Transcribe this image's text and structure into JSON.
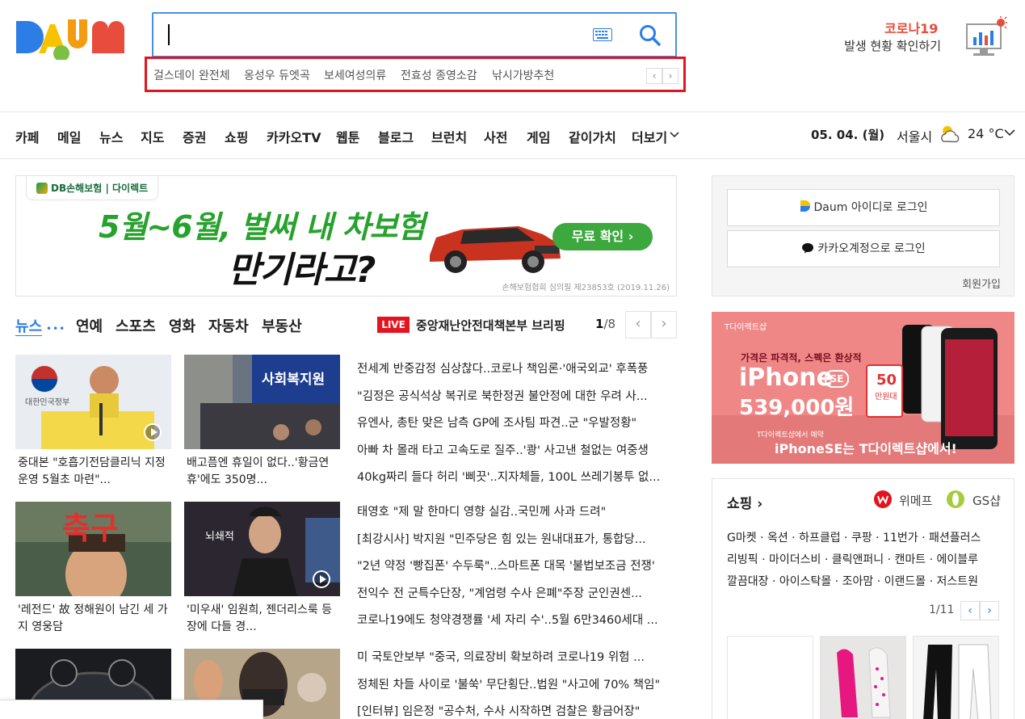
{
  "search": {
    "trends": [
      "걸스데이 완전체",
      "옹성우 듀엣곡",
      "보세여성의류",
      "전효성 종영소감",
      "낚시가방추천"
    ],
    "trend_prev": "‹",
    "trend_next": "›"
  },
  "covid": {
    "title": "코로나19",
    "subtitle": "발생 현황 확인하기"
  },
  "nav": {
    "items": [
      "카페",
      "메일",
      "뉴스",
      "지도",
      "증권",
      "쇼핑",
      "카카오TV",
      "웹툰",
      "블로그",
      "브런치",
      "사전",
      "게임",
      "같이가치",
      "더보기"
    ],
    "date": "05. 04. (월)",
    "city": "서울시",
    "temp": "24 °C"
  },
  "ad": {
    "brand": "DB손해보험 | 다이렉트",
    "line1": "5월~6월, 벌써 내 차보험",
    "line2": "만기라고?",
    "cta": "무료 확인 ›",
    "note": "손해보험협회 심의필 제23853호 (2019.11.26)"
  },
  "news": {
    "tabs": [
      "뉴스",
      "연예",
      "스포츠",
      "영화",
      "자동차",
      "부동산"
    ],
    "dots": "•••",
    "live_badge": "LIVE",
    "live_text": "중앙재난안전대책본부 브리핑",
    "page_current": "1",
    "page_total": "/8",
    "prev": "‹",
    "next": "›",
    "cards": [
      {
        "caption": "중대본 \"호흡기전담클리닉 지정운영 5월초 마련\"...",
        "thumb_text": "대한민국정부"
      },
      {
        "caption": "배고픔엔 휴일이 없다..'황금연휴'에도 350명...",
        "thumb_text": "사회복지원"
      },
      {
        "caption": "'레전드' 故 정해원이 남긴 세 가지 영웅담",
        "thumb_text": "축구"
      },
      {
        "caption": "'미우새' 임원희, 젠더리스룩 등장에 다들 경...",
        "thumb_text": "뇌쇄적"
      }
    ],
    "headlines_a": [
      "전세계 반중감정 심상찮다..코로나 책임론·'애국외교' 후폭풍",
      "\"김정은 공식석상 복귀로 북한정권 불안정에 대한 우려 사...",
      "유엔사, 총탄 맞은 남측 GP에 조사팀 파견..군 \"우발정황\"",
      "아빠 차 몰래 타고 고속도로 질주..'쾅' 사고낸 철없는 여중생",
      "40kg짜리 들다 허리 '삐끗'..지자체들, 100L 쓰레기봉투 없..."
    ],
    "headlines_b": [
      "태영호 \"제 말 한마디 영향 실감..국민께 사과 드려\"",
      "[최강시사] 박지원 \"민주당은 힘 있는 원내대표가, 통합당...",
      "\"2년 약정 '빵집폰' 수두룩\"..스마트폰 대목 '불법보조금 전쟁'",
      "전익수 전 군특수단장, \"계엄령 수사 은폐\"주장 군인권센...",
      "코로나19에도 청약경쟁률 '세 자리 수'..5월 6만3460세대 ..."
    ],
    "headlines_c": [
      "미 국토안보부 \"중국, 의료장비 확보하려 코로나19 위험 ...",
      "정체된 차들 사이로 '불쑥' 무단횡단..법원 \"사고에 70% 책임\"",
      "[인터뷰] 임은정 \"공수처, 수사 시작하면 검찰은 황금어장\""
    ]
  },
  "login": {
    "daum_login": "Daum 아이디로 로그인",
    "kakao_login": "카카오계정으로 로그인",
    "signup": "회원가입"
  },
  "iphone_ad": {
    "brand": "T다이렉트샵",
    "tagline": "가격은 파격적, 스펙은 환상적",
    "product": "iPhone",
    "se_badge": "SE",
    "price": "539,000원",
    "badge_num": "50",
    "badge_unit": "만원대",
    "footer_small": "T다이렉트샵에서 예약",
    "footer": "iPhoneSE는 T다이렉트샵에서!"
  },
  "shopping": {
    "title": "쇼핑 ›",
    "wemakeprice": "위메프",
    "gsshop": "GS샵",
    "links": [
      "G마켓 · 옥션 · 하프클럽 · 쿠팡 · 11번가 · 패션플러스",
      "리빙픽 · 마이더스비 · 클릭앤퍼니 · 캔마트 · 에이블루",
      "깔끔대장 · 아이스탁몰 · 조아맘 · 이랜드몰 · 저스트원"
    ],
    "page": "1/11",
    "prev": "‹",
    "next": "›"
  },
  "colors": {
    "accent_blue": "#2c7ee6",
    "live_red": "#e3141e",
    "covid_red": "#e74c3c",
    "ad_green": "#27a22d"
  }
}
